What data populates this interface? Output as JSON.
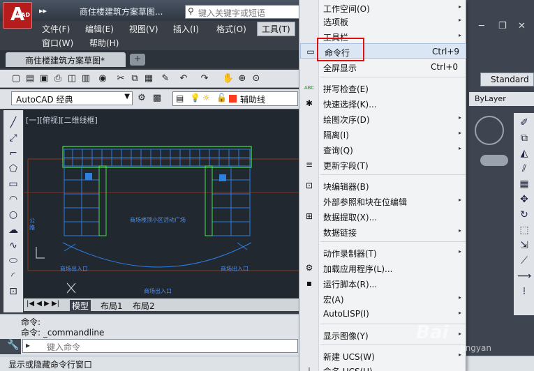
{
  "app": {
    "logo_letter": "A",
    "logo_sub": "CAD",
    "qat_glyph": "▸▸",
    "title": "商住楼建筑方案草图...",
    "search_placeholder": "键入关键字或短语"
  },
  "menubar": {
    "items": [
      {
        "label": "文件(F)"
      },
      {
        "label": "编辑(E)"
      },
      {
        "label": "视图(V)"
      },
      {
        "label": "插入(I)"
      },
      {
        "label": "格式(O)"
      },
      {
        "label": "工具(T)"
      },
      {
        "label": "窗口(W)"
      },
      {
        "label": "帮助(H)"
      }
    ]
  },
  "document_tab": {
    "label": "商住楼建筑方案草图*",
    "close": "×",
    "new_tab": "+"
  },
  "toolbar": {
    "workspace": "AutoCAD 经典",
    "layer": "辅助线",
    "text_style": "Standard",
    "bylayer": "ByLayer"
  },
  "canvas": {
    "view_label": "[一][俯视][二维线框]",
    "texts": {
      "plaza": "商场楼顶小区活动广场",
      "road": "公路",
      "entrance_left": "商场出入口",
      "entrance_right": "商场出入口",
      "entrance_bottom": "商场出入口"
    }
  },
  "layout_tabs": [
    {
      "label": "模型"
    },
    {
      "label": "布局1"
    },
    {
      "label": "布局2"
    }
  ],
  "command": {
    "history": [
      "命令:",
      "命令: _commandline"
    ],
    "input_placeholder": "键入命令"
  },
  "status": {
    "text": "显示或隐藏命令行窗口"
  },
  "dropdown_menu": {
    "items": [
      {
        "label": "工作空间(O)",
        "shortcut": "",
        "submenu": true
      },
      {
        "label": "选项板",
        "shortcut": "",
        "submenu": true
      },
      {
        "label": "工具栏",
        "shortcut": "",
        "submenu": true
      },
      {
        "label": "命令行",
        "shortcut": "Ctrl+9",
        "submenu": false
      },
      {
        "label": "全屏显示",
        "shortcut": "Ctrl+0",
        "submenu": false
      },
      {
        "label": "拼写检查(E)",
        "shortcut": "",
        "submenu": false
      },
      {
        "label": "快速选择(K)...",
        "shortcut": "",
        "submenu": false
      },
      {
        "label": "绘图次序(D)",
        "shortcut": "",
        "submenu": true
      },
      {
        "label": "隔离(I)",
        "shortcut": "",
        "submenu": true
      },
      {
        "label": "查询(Q)",
        "shortcut": "",
        "submenu": true
      },
      {
        "label": "更新字段(T)",
        "shortcut": "",
        "submenu": false
      },
      {
        "label": "块编辑器(B)",
        "shortcut": "",
        "submenu": false
      },
      {
        "label": "外部参照和块在位编辑",
        "shortcut": "",
        "submenu": true
      },
      {
        "label": "数据提取(X)...",
        "shortcut": "",
        "submenu": false
      },
      {
        "label": "数据链接",
        "shortcut": "",
        "submenu": true
      },
      {
        "label": "动作录制器(T)",
        "shortcut": "",
        "submenu": true
      },
      {
        "label": "加载应用程序(L)...",
        "shortcut": "",
        "submenu": false
      },
      {
        "label": "运行脚本(R)...",
        "shortcut": "",
        "submenu": false
      },
      {
        "label": "宏(A)",
        "shortcut": "",
        "submenu": true
      },
      {
        "label": "AutoLISP(I)",
        "shortcut": "",
        "submenu": true
      },
      {
        "label": "显示图像(Y)",
        "shortcut": "",
        "submenu": true
      },
      {
        "label": "新建 UCS(W)",
        "shortcut": "",
        "submenu": true
      },
      {
        "label": "命名 UCS(U)...",
        "shortcut": "",
        "submenu": false
      }
    ],
    "icon_glyphs": {
      "abc": "ABC",
      "arrow": "▸"
    }
  },
  "watermark": {
    "logo": "Bai",
    "sub": "jingyan"
  },
  "colors": {
    "menu_highlight": "#dbe6f4",
    "callout": "#e01010",
    "canvas_bg": "#212830",
    "drawing": "#2d7fe0",
    "drawing_accent": "#46e24a"
  }
}
